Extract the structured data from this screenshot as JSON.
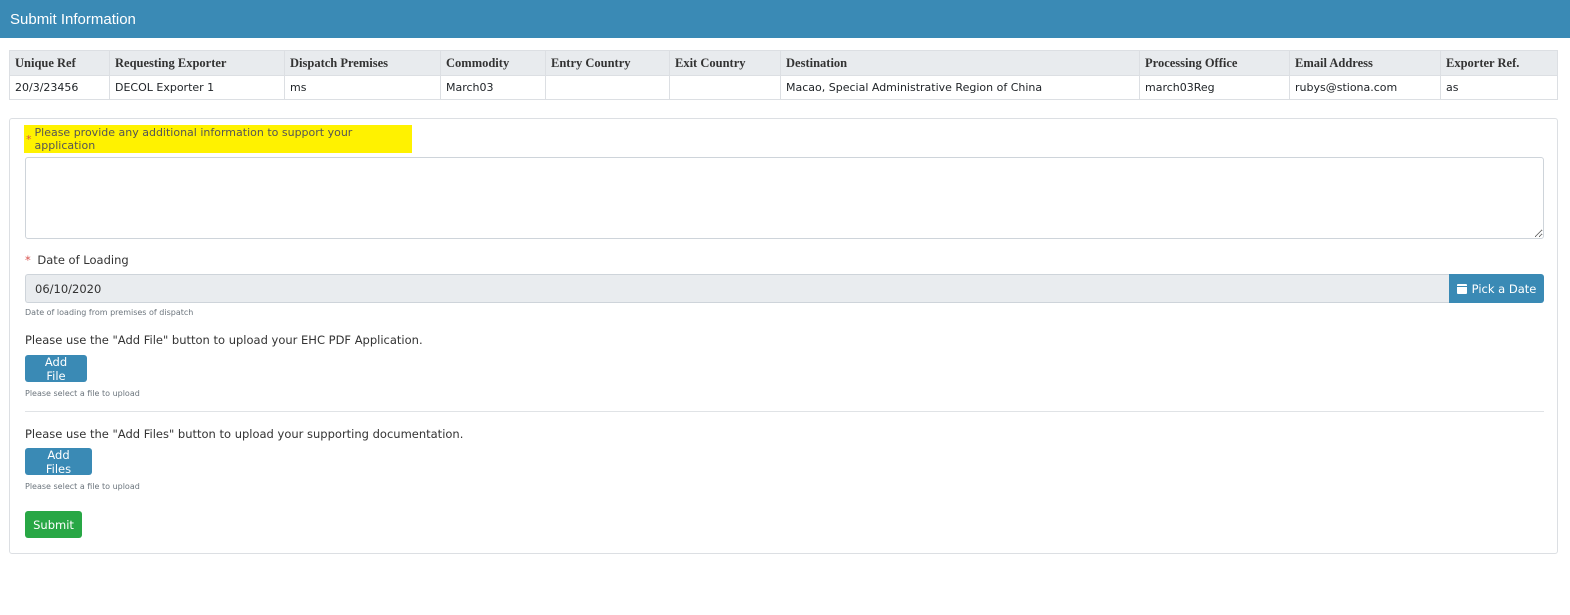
{
  "header": {
    "title": "Submit Information"
  },
  "summary_table": {
    "columns": [
      "Unique Ref",
      "Requesting Exporter",
      "Dispatch Premises",
      "Commodity",
      "Entry Country",
      "Exit Country",
      "Destination",
      "Processing Office",
      "Email Address",
      "Exporter Ref."
    ],
    "rows": [
      [
        "20/3/23456",
        "DECOL Exporter 1",
        "ms",
        "March03",
        "",
        "",
        "Macao, Special Administrative Region of China",
        "march03Reg",
        "rubys@stiona.com",
        "as"
      ]
    ]
  },
  "form": {
    "required_marker": "*",
    "additional_info_label": "Please provide any additional information to support your application",
    "additional_info_value": "",
    "date_label": "Date of Loading",
    "date_value": "06/10/2020",
    "pick_date_label": "Pick a Date",
    "date_help": "Date of loading from premises of dispatch",
    "ehc_instruction": "Please use the \"Add File\" button to upload your EHC PDF Application.",
    "add_file_label": "Add File",
    "add_file_help": "Please select a file to upload",
    "supporting_instruction": "Please use the \"Add Files\" button to upload your supporting documentation.",
    "add_files_label": "Add Files",
    "add_files_help": "Please select a file to upload",
    "submit_label": "Submit"
  },
  "colors": {
    "brand": "#3a8ab5",
    "submit": "#28a745",
    "highlight": "#fff200",
    "required": "#d9534f"
  },
  "icons": {
    "pick_date": "calendar-icon"
  }
}
